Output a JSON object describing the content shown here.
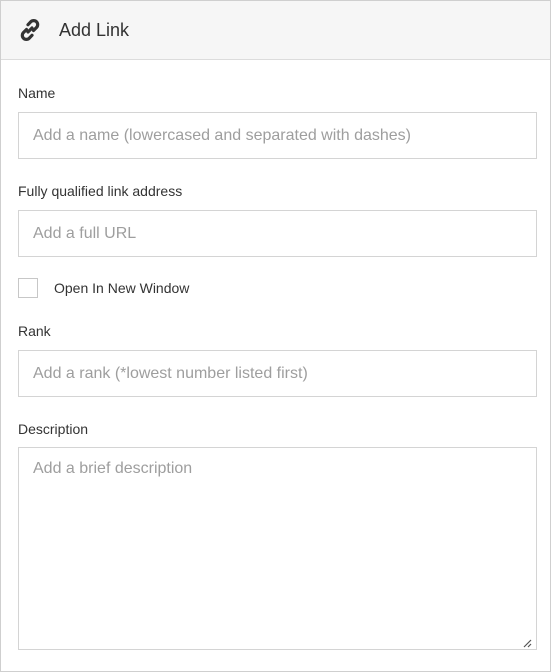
{
  "header": {
    "title": "Add Link",
    "icon": "link-icon"
  },
  "form": {
    "name": {
      "label": "Name",
      "placeholder": "Add a name (lowercased and separated with dashes)"
    },
    "url": {
      "label": "Fully qualified link address",
      "placeholder": "Add a full URL"
    },
    "new_window": {
      "label": "Open In New Window",
      "checked": false
    },
    "rank": {
      "label": "Rank",
      "placeholder": "Add a rank (*lowest number listed first)"
    },
    "description": {
      "label": "Description",
      "placeholder": "Add a brief description"
    }
  },
  "colors": {
    "header_bg": "#f6f6f6",
    "border": "#d4d4d4",
    "placeholder": "#9e9e9e",
    "text": "#333333"
  }
}
